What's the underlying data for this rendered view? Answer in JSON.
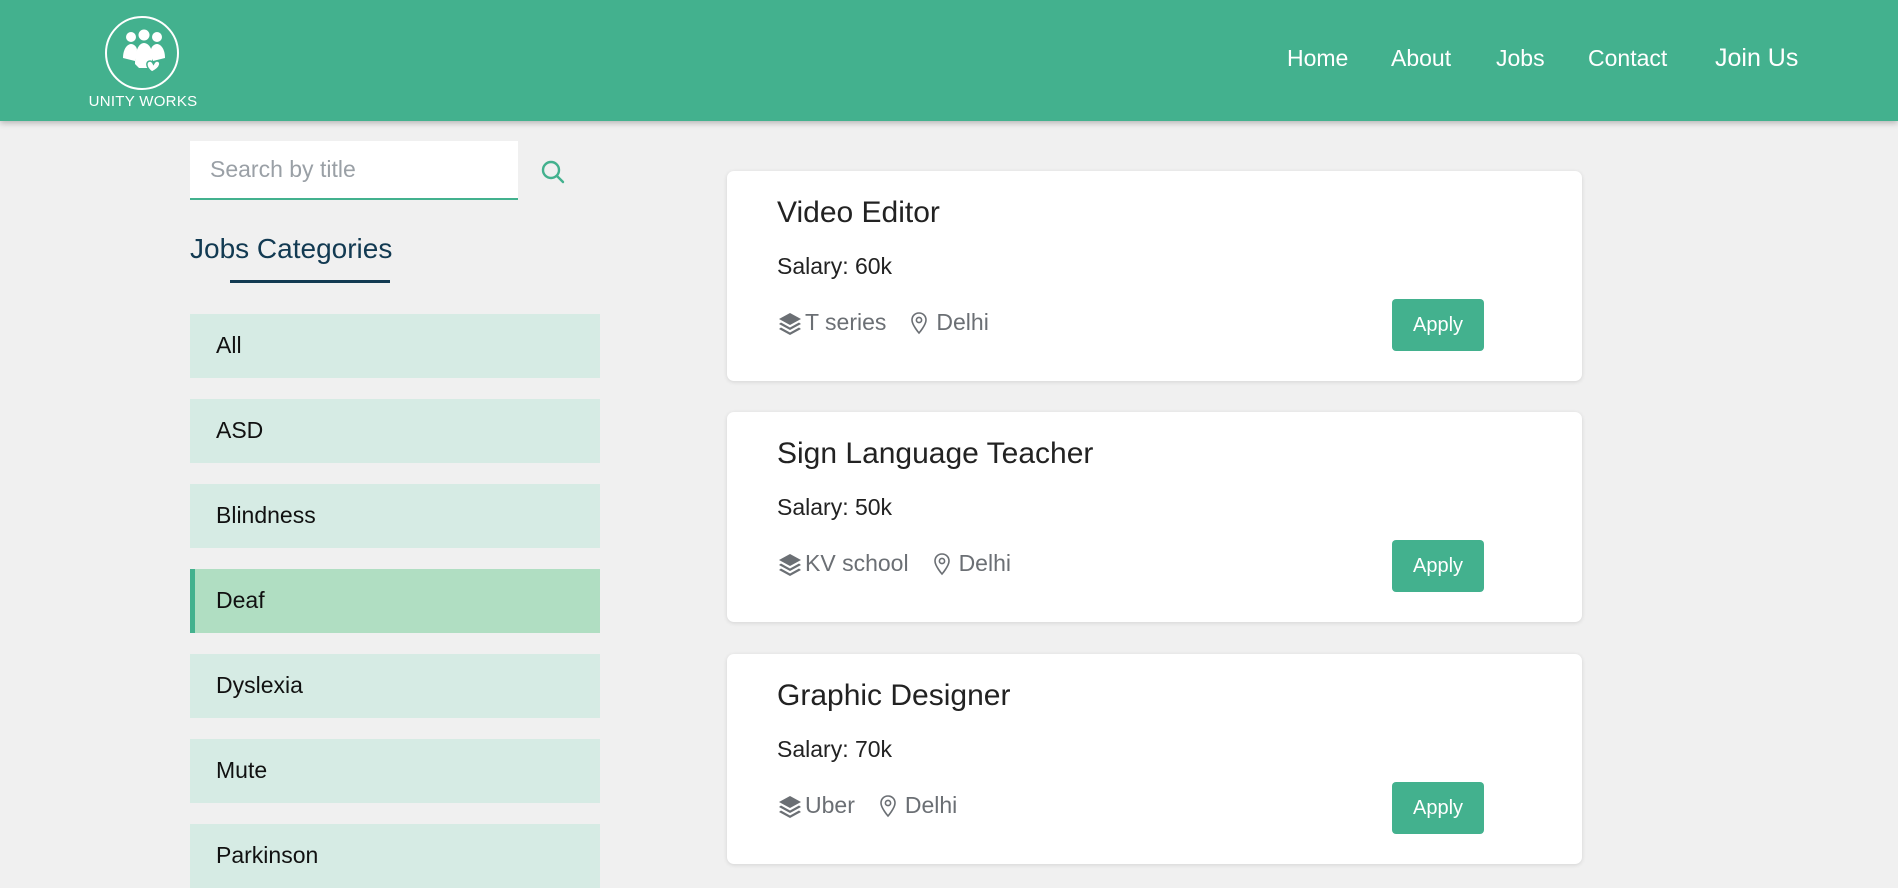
{
  "brand": {
    "name": "UNITY WORKS",
    "logo_icon": "people-heart-icon"
  },
  "nav": {
    "home": "Home",
    "about": "About",
    "jobs": "Jobs",
    "contact": "Contact",
    "join": "Join Us"
  },
  "search": {
    "placeholder": "Search by title",
    "value": ""
  },
  "categories": {
    "title": "Jobs Categories",
    "items": [
      {
        "label": "All",
        "active": false
      },
      {
        "label": "ASD",
        "active": false
      },
      {
        "label": "Blindness",
        "active": false
      },
      {
        "label": "Deaf",
        "active": true
      },
      {
        "label": "Dyslexia",
        "active": false
      },
      {
        "label": "Mute",
        "active": false
      },
      {
        "label": "Parkinson",
        "active": false
      }
    ]
  },
  "jobs": [
    {
      "title": "Video Editor",
      "salary": "Salary: 60k",
      "company": "T series",
      "location": "Delhi",
      "apply": "Apply"
    },
    {
      "title": "Sign Language Teacher",
      "salary": "Salary: 50k",
      "company": "KV school",
      "location": "Delhi",
      "apply": "Apply"
    },
    {
      "title": "Graphic Designer",
      "salary": "Salary: 70k",
      "company": "Uber",
      "location": "Delhi",
      "apply": "Apply"
    }
  ],
  "colors": {
    "primary": "#43b18e",
    "background": "#f0f0f0",
    "category_bg": "#d6ebe4",
    "category_active_bg": "#b0dec2",
    "heading": "#123a52"
  }
}
